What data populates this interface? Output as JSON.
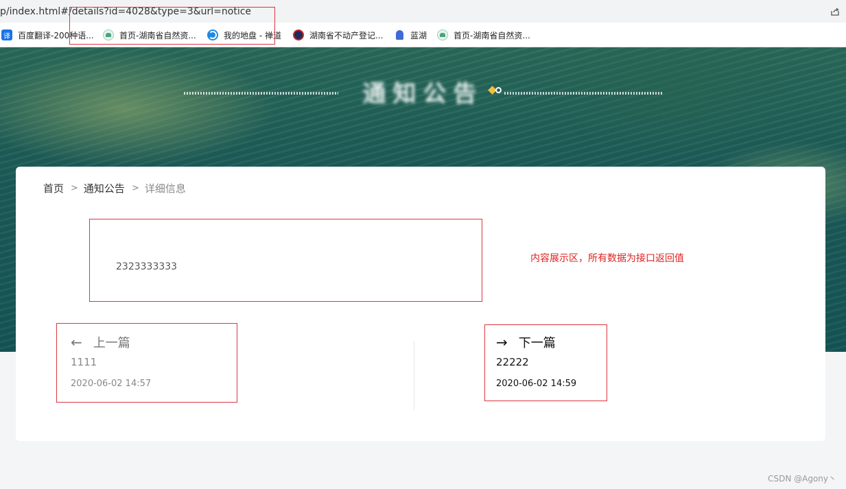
{
  "browser": {
    "url": "p/index.html#/details?id=4028&type=3&url=notice",
    "bookmarks": [
      {
        "label": "百度翻译-200种语...",
        "icon": "translate-icon"
      },
      {
        "label": "首页-湖南省自然资...",
        "icon": "hunan-logo-icon"
      },
      {
        "label": "我的地盘 - 禅道",
        "icon": "zentao-icon"
      },
      {
        "label": "湖南省不动产登记...",
        "icon": "emblem-icon"
      },
      {
        "label": "蓝湖",
        "icon": "lanhu-icon"
      },
      {
        "label": "首页-湖南省自然资...",
        "icon": "hunan-logo-icon"
      }
    ],
    "bookmark_icon_text": "译"
  },
  "hero": {
    "title": "通知公告"
  },
  "breadcrumb": {
    "home": "首页",
    "section": "通知公告",
    "current": "详细信息",
    "separator": ">"
  },
  "content": {
    "body": "2323333333",
    "annotation": "内容展示区，所有数据为接口返回值"
  },
  "prev": {
    "arrow": "←",
    "label": "上一篇",
    "title": "1111",
    "date": "2020-06-02 14:57"
  },
  "next": {
    "arrow": "→",
    "label": "下一篇",
    "title": "22222",
    "date": "2020-06-02 14:59"
  },
  "watermark": "CSDN @Agony丶",
  "colors": {
    "annotation_red": "#e02020",
    "hero_green": "#1c5c58"
  }
}
